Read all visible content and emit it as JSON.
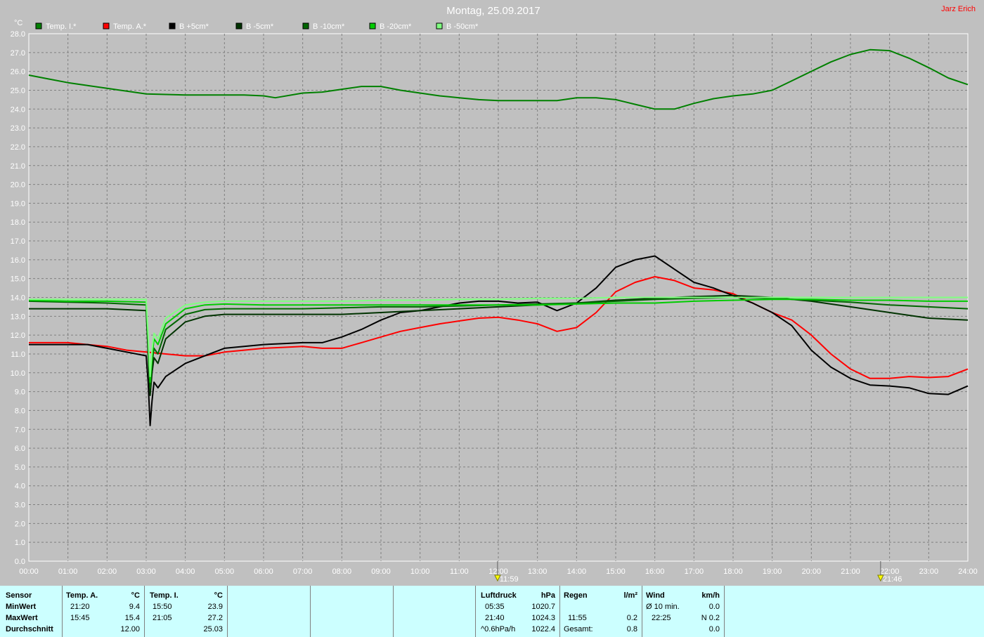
{
  "header": {
    "title": "Montag, 25.09.2017",
    "author": "Jarz Erich"
  },
  "chart_data": {
    "type": "line",
    "ylabel": "°C",
    "ylim": [
      0,
      28
    ],
    "xlim": [
      0,
      24
    ],
    "y_ticks": [
      "0.0",
      "1.0",
      "2.0",
      "3.0",
      "4.0",
      "5.0",
      "6.0",
      "7.0",
      "8.0",
      "9.0",
      "10.0",
      "11.0",
      "12.0",
      "13.0",
      "14.0",
      "15.0",
      "16.0",
      "17.0",
      "18.0",
      "19.0",
      "20.0",
      "21.0",
      "22.0",
      "23.0",
      "24.0",
      "25.0",
      "26.0",
      "27.0",
      "28.0"
    ],
    "x_ticks": [
      "00:00",
      "01:00",
      "02:00",
      "03:00",
      "04:00",
      "05:00",
      "06:00",
      "07:00",
      "08:00",
      "09:00",
      "10:00",
      "11:00",
      "12:00",
      "13:00",
      "14:00",
      "15:00",
      "16:00",
      "17:00",
      "18:00",
      "19:00",
      "20:00",
      "21:00",
      "22:00",
      "23:00",
      "24:00"
    ],
    "grid": true,
    "legend_position": "top",
    "markers": [
      {
        "label": "11:59",
        "x": 11.98,
        "icon": "sun-icon"
      },
      {
        "label": "21:46",
        "x": 21.77,
        "icon": "moon-icon"
      }
    ],
    "series": [
      {
        "name": "Temp. I.*",
        "color": "#008000",
        "x": [
          0,
          0.5,
          1,
          1.5,
          2,
          2.5,
          3,
          4,
          5,
          5.5,
          6,
          6.3,
          7,
          7.5,
          8,
          8.5,
          9,
          9.5,
          10,
          10.5,
          11,
          11.5,
          12,
          12.5,
          13,
          13.5,
          14,
          14.5,
          15,
          15.5,
          16,
          16.5,
          17,
          17.5,
          18,
          18.5,
          19,
          19.5,
          20,
          20.5,
          21,
          21.5,
          22,
          22.5,
          23,
          23.5,
          24
        ],
        "y": [
          25.8,
          25.6,
          25.4,
          25.25,
          25.1,
          24.95,
          24.8,
          24.75,
          24.75,
          24.75,
          24.7,
          24.6,
          24.85,
          24.9,
          25.05,
          25.2,
          25.2,
          25.0,
          24.85,
          24.7,
          24.6,
          24.5,
          24.45,
          24.45,
          24.45,
          24.45,
          24.6,
          24.6,
          24.5,
          24.25,
          24.0,
          24.0,
          24.3,
          24.55,
          24.7,
          24.8,
          25.0,
          25.5,
          26.0,
          26.5,
          26.9,
          27.15,
          27.1,
          26.7,
          26.2,
          25.65,
          25.3
        ]
      },
      {
        "name": "Temp. A.*",
        "color": "#ff0000",
        "x": [
          0,
          1,
          1.5,
          2,
          2.5,
          3,
          3.5,
          4,
          4.5,
          5,
          5.5,
          6,
          6.5,
          7,
          7.5,
          8,
          8.5,
          9,
          9.5,
          10,
          10.5,
          11,
          11.5,
          12,
          12.5,
          13,
          13.5,
          14,
          14.5,
          15,
          15.5,
          16,
          16.5,
          17,
          17.5,
          18,
          18.5,
          19,
          19.5,
          20,
          20.5,
          21,
          21.5,
          22,
          22.5,
          23,
          23.5,
          24
        ],
        "y": [
          11.6,
          11.6,
          11.5,
          11.4,
          11.2,
          11.1,
          11.0,
          10.9,
          10.9,
          11.1,
          11.2,
          11.3,
          11.35,
          11.4,
          11.3,
          11.3,
          11.6,
          11.9,
          12.2,
          12.4,
          12.6,
          12.75,
          12.9,
          12.95,
          12.8,
          12.6,
          12.2,
          12.4,
          13.2,
          14.3,
          14.8,
          15.1,
          14.9,
          14.5,
          14.4,
          14.2,
          13.7,
          13.2,
          12.8,
          12.0,
          11.0,
          10.2,
          9.7,
          9.7,
          9.8,
          9.75,
          9.8,
          10.2
        ]
      },
      {
        "name": "B +5cm*",
        "color": "#000000",
        "x": [
          0,
          0.5,
          1,
          1.5,
          2,
          2.5,
          3,
          3.05,
          3.1,
          3.15,
          3.2,
          3.3,
          3.5,
          4,
          4.5,
          5,
          5.5,
          6,
          6.5,
          7,
          7.5,
          8,
          8.5,
          9,
          9.5,
          10,
          10.5,
          11,
          11.5,
          12,
          12.5,
          13,
          13.5,
          14,
          14.5,
          15,
          15.5,
          16,
          16.5,
          17,
          17.5,
          18,
          18.5,
          19,
          19.5,
          20,
          20.5,
          21,
          21.5,
          22,
          22.5,
          23,
          23.5,
          24
        ],
        "y": [
          11.5,
          11.5,
          11.5,
          11.5,
          11.3,
          11.1,
          10.9,
          9.5,
          7.2,
          8.5,
          9.5,
          9.2,
          9.8,
          10.5,
          10.9,
          11.3,
          11.4,
          11.5,
          11.55,
          11.6,
          11.6,
          11.9,
          12.3,
          12.8,
          13.2,
          13.3,
          13.5,
          13.7,
          13.8,
          13.8,
          13.7,
          13.75,
          13.3,
          13.7,
          14.5,
          15.6,
          16.0,
          16.2,
          15.5,
          14.8,
          14.5,
          14.1,
          13.7,
          13.2,
          12.5,
          11.2,
          10.3,
          9.7,
          9.35,
          9.3,
          9.2,
          8.9,
          8.85,
          9.3
        ]
      },
      {
        "name": "B -5cm*",
        "color": "#003300",
        "x": [
          0,
          1,
          2,
          3,
          3.05,
          3.1,
          3.15,
          3.2,
          3.3,
          3.5,
          4,
          4.5,
          5,
          6,
          7,
          8,
          9,
          10,
          11,
          12,
          13,
          14,
          15,
          16,
          17,
          18,
          19,
          20,
          21,
          22,
          23,
          24
        ],
        "y": [
          13.4,
          13.4,
          13.4,
          13.3,
          11.0,
          8.8,
          10.0,
          10.8,
          10.5,
          11.8,
          12.7,
          13.0,
          13.1,
          13.1,
          13.1,
          13.1,
          13.2,
          13.3,
          13.4,
          13.5,
          13.6,
          13.7,
          13.85,
          13.95,
          14.05,
          14.1,
          14.0,
          13.8,
          13.5,
          13.2,
          12.9,
          12.8
        ]
      },
      {
        "name": "B -10cm*",
        "color": "#006600",
        "x": [
          0,
          1,
          2,
          3,
          3.05,
          3.1,
          3.15,
          3.2,
          3.3,
          3.5,
          4,
          4.5,
          5,
          6,
          7,
          8,
          9,
          10,
          11,
          12,
          13,
          14,
          15,
          16,
          17,
          18,
          19,
          20,
          21,
          22,
          23,
          24
        ],
        "y": [
          13.8,
          13.75,
          13.7,
          13.6,
          11.5,
          9.2,
          10.5,
          11.3,
          11.0,
          12.3,
          13.1,
          13.35,
          13.4,
          13.4,
          13.4,
          13.45,
          13.5,
          13.5,
          13.55,
          13.6,
          13.65,
          13.7,
          13.8,
          13.9,
          13.95,
          14.0,
          13.95,
          13.85,
          13.75,
          13.6,
          13.5,
          13.4
        ]
      },
      {
        "name": "B -20cm*",
        "color": "#00cc00",
        "x": [
          0,
          1,
          2,
          3,
          3.05,
          3.1,
          3.15,
          3.2,
          3.3,
          3.5,
          4,
          4.5,
          5,
          6,
          7,
          8,
          9,
          10,
          11,
          12,
          13,
          14,
          15,
          16,
          17,
          18,
          19,
          20,
          21,
          22,
          23,
          24
        ],
        "y": [
          13.85,
          13.8,
          13.8,
          13.75,
          11.8,
          9.5,
          10.8,
          11.8,
          11.5,
          12.6,
          13.4,
          13.6,
          13.65,
          13.6,
          13.6,
          13.6,
          13.6,
          13.6,
          13.6,
          13.6,
          13.6,
          13.65,
          13.7,
          13.7,
          13.8,
          13.85,
          13.9,
          13.9,
          13.85,
          13.85,
          13.8,
          13.8
        ]
      },
      {
        "name": "B -50cm*",
        "color": "#80ff80",
        "x": [
          0,
          1,
          2,
          3,
          3.05,
          3.1,
          3.15,
          3.2,
          3.3,
          3.5,
          4,
          4.5,
          5,
          6,
          7,
          8,
          9,
          10,
          11,
          12,
          13,
          14,
          15,
          16,
          17,
          18,
          19,
          20,
          21,
          22,
          23,
          24
        ],
        "y": [
          13.9,
          13.9,
          13.9,
          13.9,
          12.0,
          9.8,
          11.2,
          12.1,
          11.8,
          12.9,
          13.6,
          13.75,
          13.8,
          13.8,
          13.8,
          13.8,
          13.85,
          13.85,
          13.9,
          13.9,
          13.95,
          13.95,
          14.0,
          14.0,
          14.0,
          14.0,
          14.0,
          14.0,
          14.0,
          14.0,
          14.0,
          14.0
        ]
      }
    ]
  },
  "stats": {
    "sensor": {
      "header": "Sensor",
      "rows": [
        "MinWert",
        "MaxWert",
        "Durchschnitt"
      ]
    },
    "temp_a": {
      "header": "Temp. A.",
      "unit": "°C",
      "min_time": "21:20",
      "min_val": "9.4",
      "max_time": "15:45",
      "max_val": "15.4",
      "avg": "12.00"
    },
    "temp_i": {
      "header": "Temp. I.",
      "unit": "°C",
      "min_time": "15:50",
      "min_val": "23.9",
      "max_time": "21:05",
      "max_val": "27.2",
      "avg": "25.03"
    },
    "pressure": {
      "header": "Luftdruck",
      "unit": "hPa",
      "min_time": "05:35",
      "min_val": "1020.7",
      "max_time": "21:40",
      "max_val": "1024.3",
      "trend": "^0.6hPa/h",
      "avg": "1022.4"
    },
    "rain": {
      "header": "Regen",
      "unit": "l/m²",
      "max_time": "11:55",
      "max_val": "0.2",
      "total_label": "Gesamt:",
      "total": "0.8"
    },
    "wind": {
      "header": "Wind",
      "unit": "km/h",
      "avg_label": "Ø 10 min.",
      "avg_val": "0.0",
      "max_time": "22:25",
      "max_val": "N 0.2",
      "avg": "0.0"
    }
  }
}
